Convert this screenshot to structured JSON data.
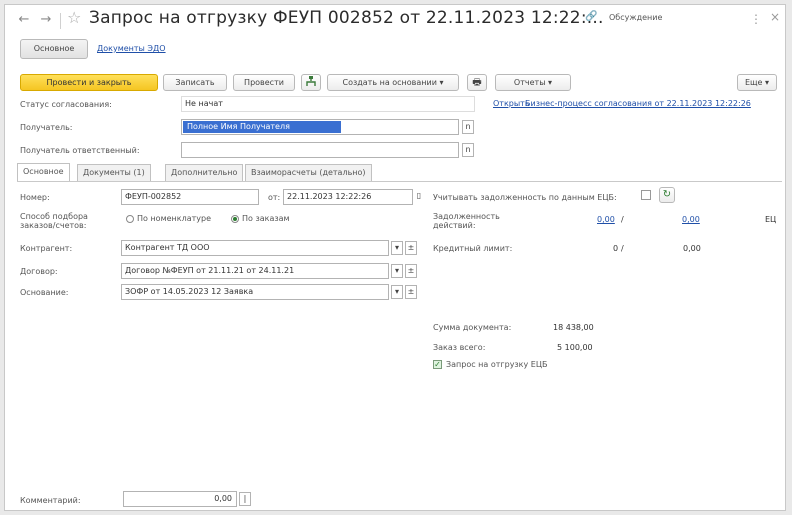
{
  "window": {
    "title": "Запрос на отгрузку ФЕУП 002852 от 22.11.2023 12:22:...",
    "nav_back": "←",
    "nav_forward": "→",
    "star": "☆",
    "link_icon": "🔗",
    "discussions": "Обсуждение",
    "menu_dots": "⋮",
    "close": "×"
  },
  "form_tabs": {
    "main": "Основное",
    "doc": "Документы ЭДО"
  },
  "toolbar": {
    "post_close": "Провести и закрыть",
    "save": "Записать",
    "post": "Провести",
    "create_based": "Создать на основании ▾",
    "print_icon": "🖶",
    "reports": "Отчеты ▾",
    "more": "Еще ▾"
  },
  "header": {
    "status_label": "Статус согласования:",
    "status_value": "Не начат",
    "open_link": "Открыть",
    "process_link": "Бизнес-процесс согласования от 22.11.2023 12:22:26",
    "recipient_label": "Получатель:",
    "recipient_value": "Полное Имя Получателя",
    "resp_label": "Получатель ответственный:",
    "resp_value": ""
  },
  "tabs": [
    {
      "label": "Основное"
    },
    {
      "label": "Документы (1)"
    },
    {
      "label": "Дополнительно"
    },
    {
      "label": "Взаиморасчеты (детально)"
    }
  ],
  "left": {
    "number_label": "Номер:",
    "number_value": "ФЕУП-002852",
    "date_sep": "от:",
    "date_value": "22.11.2023 12:22:26",
    "method_label": "Способ подбора",
    "method_label2": "заказов/счетов:",
    "radio1": "По номенклатуре",
    "radio2": "По заказам",
    "contractor_label": "Контрагент:",
    "contractor_value": "Контрагент ТД ООО",
    "contract_label": "Договор:",
    "contract_value": "Договор №ФЕУП от 21.11.21 от 24.11.21",
    "basis_label": "Основание:",
    "basis_value": "ЗОФР от 14.05.2023 12 Заявка",
    "note_label": "Комментарий:",
    "note_value": "0,00"
  },
  "right": {
    "consider_label": "Учитывать задолженность по данным ЕЦБ:",
    "debt_label": "Задолженность",
    "debt_label2": "действий:",
    "debt_val1": "0,00",
    "debt_val2": "0,00",
    "debt_sep": "/",
    "debt_currency": "ЕЦ",
    "limit_label": "Кредитный лимит:",
    "limit_val1": "0",
    "limit_sep": "/",
    "limit_val2": "0,00",
    "total_label": "Сумма документа:",
    "total_value": "18 438,00",
    "order_label": "Заказ всего:",
    "order_value": "5 100,00",
    "checkbox_label": "Запрос на отгрузку ЕЦБ"
  }
}
